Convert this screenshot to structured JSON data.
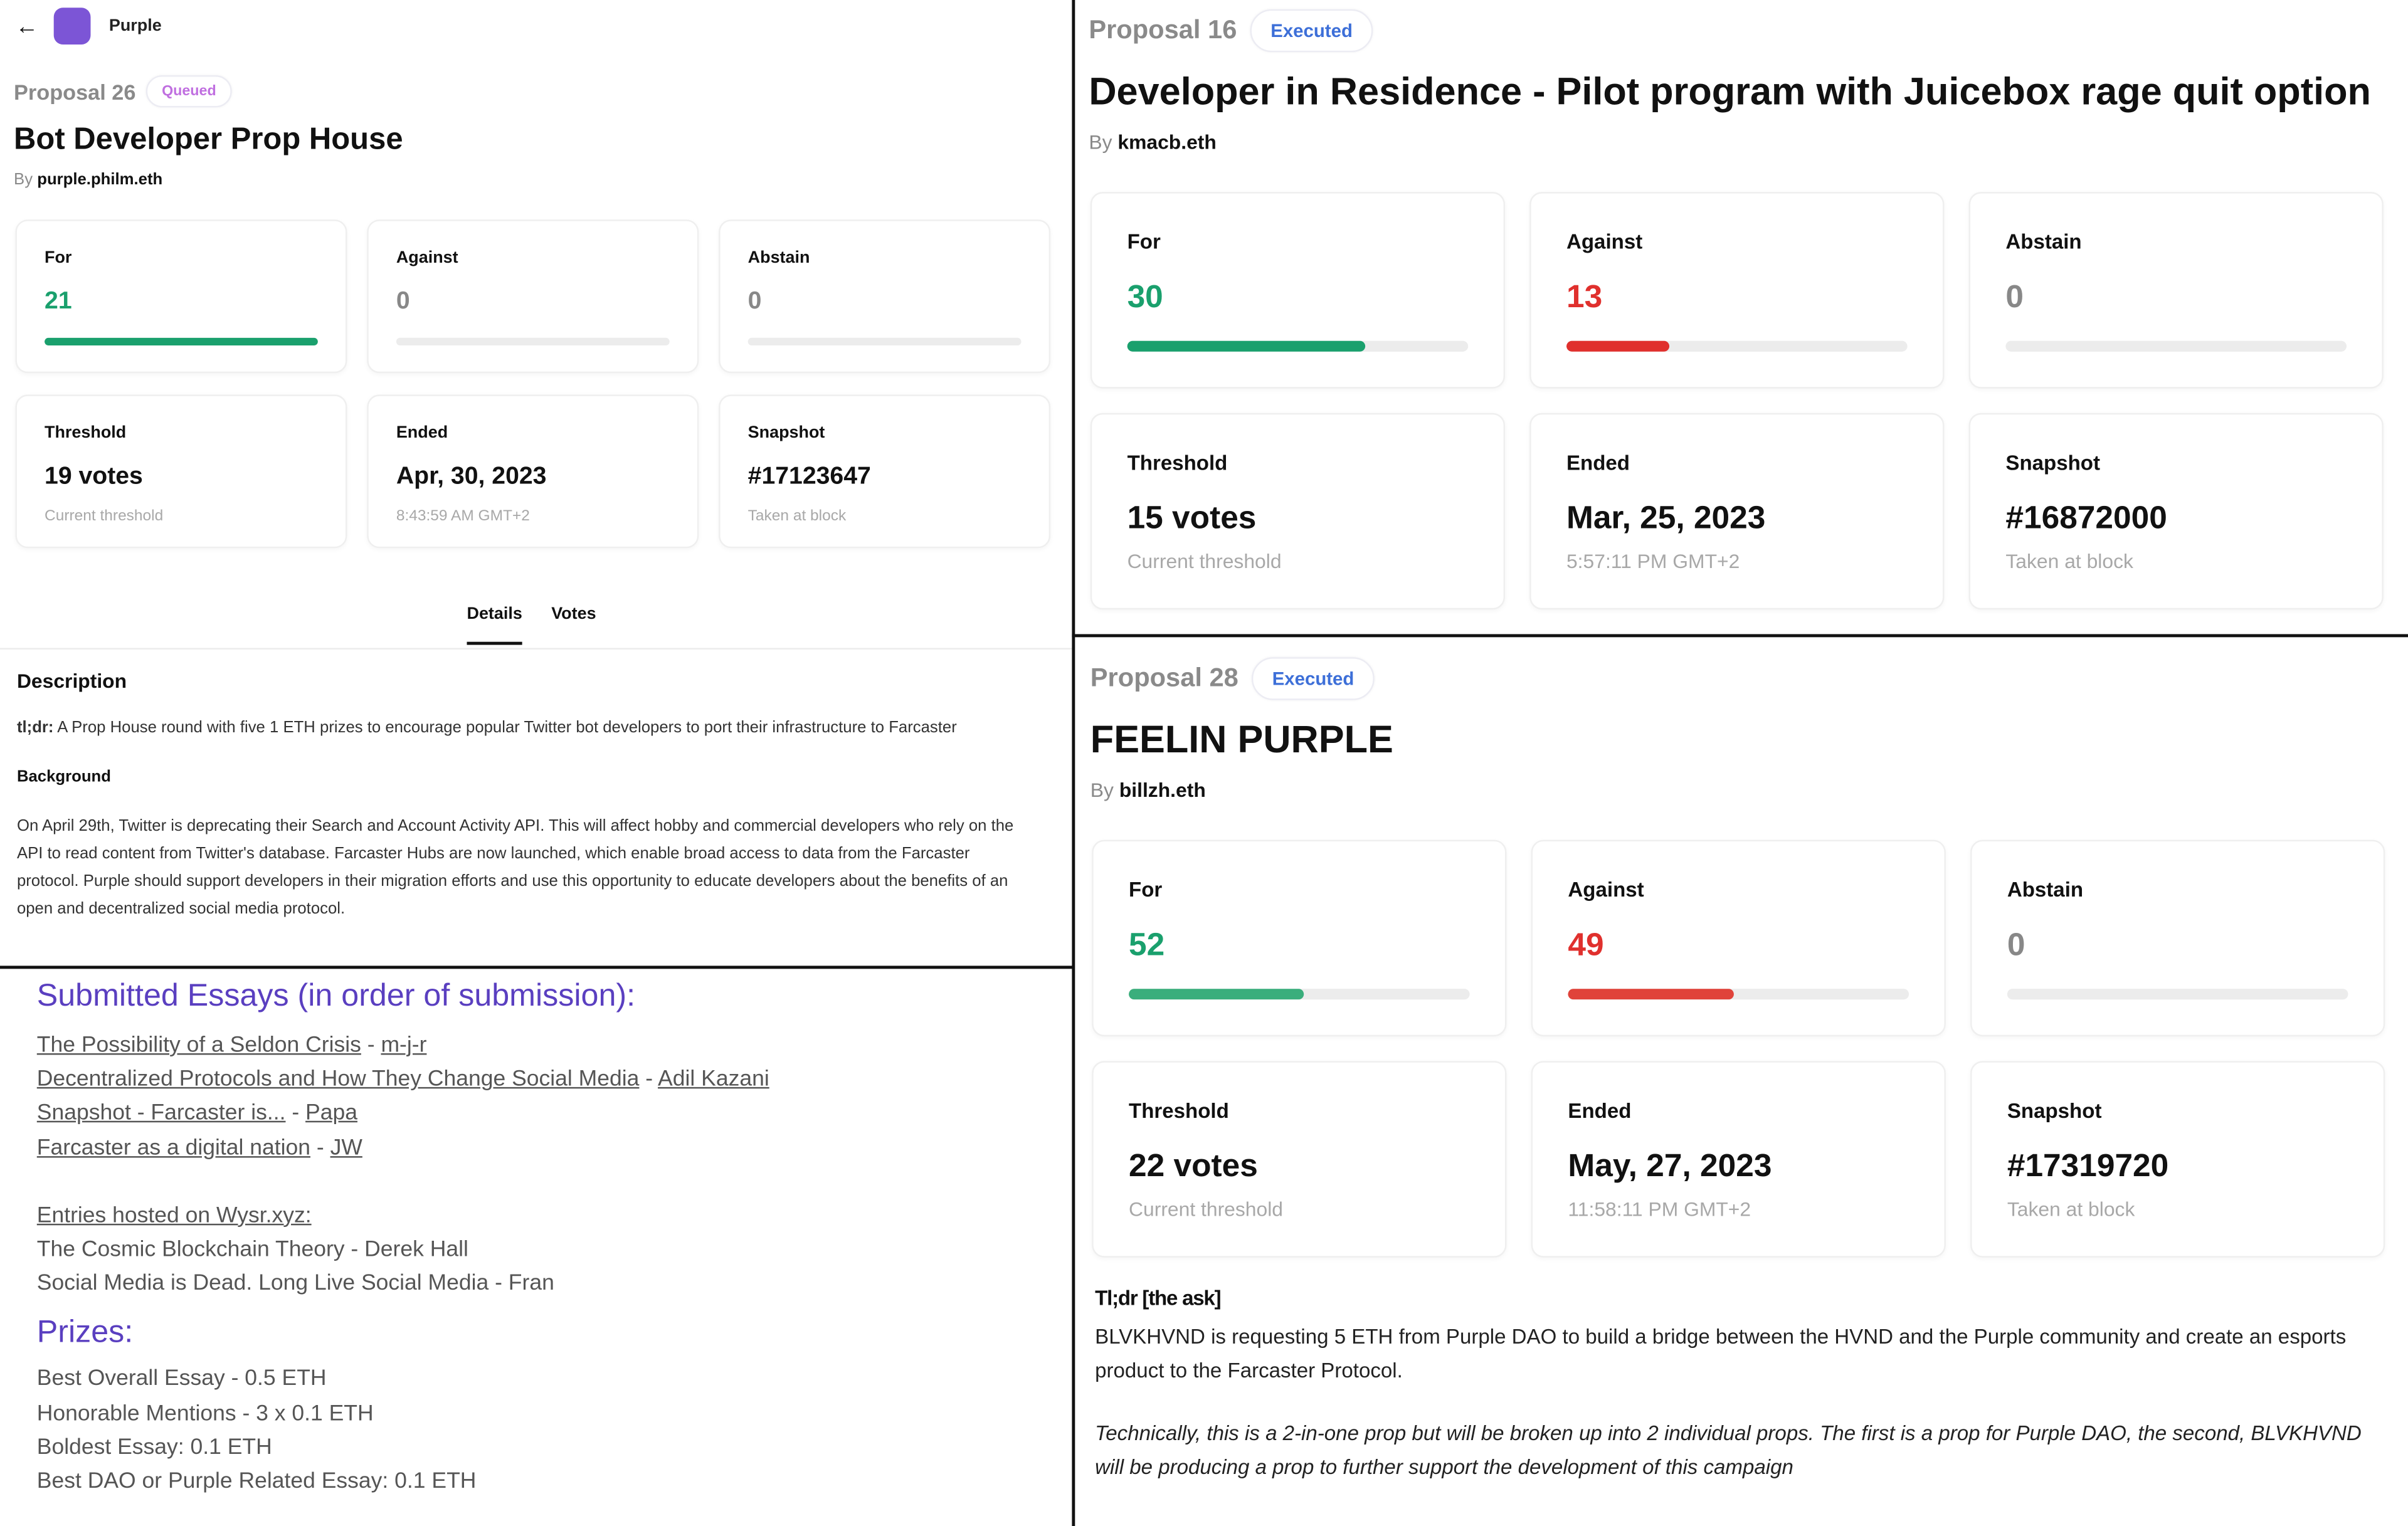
{
  "nav": {
    "back_label": "←",
    "dao_name": "Purple",
    "logo_color": "#7c55d6"
  },
  "colors": {
    "for": "#1aa06d",
    "against": "#e0302d",
    "abstain": "#888888",
    "queued": "#c06fe0",
    "executed": "#3d6fd8",
    "heading_purple": "#5a3fc0"
  },
  "proposals": [
    {
      "number": "Proposal 26",
      "status": "Queued",
      "title": "Bot Developer Prop House",
      "by_label": "By",
      "author": "purple.philm.eth",
      "votes": {
        "for": {
          "label": "For",
          "value": "21",
          "share": 1.0
        },
        "against": {
          "label": "Against",
          "value": "0",
          "share": 0
        },
        "abstain": {
          "label": "Abstain",
          "value": "0",
          "share": 0
        }
      },
      "threshold": {
        "label": "Threshold",
        "value": "19 votes",
        "sub": "Current threshold"
      },
      "ended": {
        "label": "Ended",
        "value": "Apr, 30, 2023",
        "sub": "8:43:59 AM GMT+2"
      },
      "snapshot": {
        "label": "Snapshot",
        "value": "#17123647",
        "sub": "Taken at block"
      },
      "tabs": [
        {
          "label": "Details",
          "active": true
        },
        {
          "label": "Votes",
          "active": false
        }
      ],
      "description": {
        "heading": "Description",
        "tldr_label": "tl;dr:",
        "tldr_text": " A Prop House round with five 1 ETH prizes to encourage popular Twitter bot developers to port their infrastructure to Farcaster",
        "background_heading": "Background",
        "background_text": "On April 29th, Twitter is deprecating their Search and Account Activity API. This will affect hobby and commercial developers who rely on the API to read content from Twitter's database. Farcaster Hubs are now launched, which enable broad access to data from the Farcaster protocol. Purple should support developers in their migration efforts and use this opportunity to educate developers about the benefits of an open and decentralized social media protocol."
      }
    },
    {
      "number": "Proposal 16",
      "status": "Executed",
      "title": "Developer in Residence - Pilot program with Juicebox rage quit option",
      "by_label": "By",
      "author": "kmacb.eth",
      "votes": {
        "for": {
          "label": "For",
          "value": "30",
          "share": 0.698
        },
        "against": {
          "label": "Against",
          "value": "13",
          "share": 0.302
        },
        "abstain": {
          "label": "Abstain",
          "value": "0",
          "share": 0
        }
      },
      "threshold": {
        "label": "Threshold",
        "value": "15 votes",
        "sub": "Current threshold"
      },
      "ended": {
        "label": "Ended",
        "value": "Mar, 25, 2023",
        "sub": "5:57:11 PM GMT+2"
      },
      "snapshot": {
        "label": "Snapshot",
        "value": "#16872000",
        "sub": "Taken at block"
      }
    },
    {
      "number": "Proposal 28",
      "status": "Executed",
      "title": "FEELIN PURPLE",
      "by_label": "By",
      "author": "billzh.eth",
      "votes": {
        "for": {
          "label": "For",
          "value": "52",
          "share": 0.515
        },
        "against": {
          "label": "Against",
          "value": "49",
          "share": 0.485
        },
        "abstain": {
          "label": "Abstain",
          "value": "0",
          "share": 0
        }
      },
      "threshold": {
        "label": "Threshold",
        "value": "22 votes",
        "sub": "Current threshold"
      },
      "ended": {
        "label": "Ended",
        "value": "May, 27, 2023",
        "sub": "11:58:11 PM GMT+2"
      },
      "snapshot": {
        "label": "Snapshot",
        "value": "#17319720",
        "sub": "Taken at block"
      },
      "ask": {
        "heading": "Tl;dr [the ask]",
        "text": "BLVKHVND is requesting 5 ETH from Purple DAO to build a bridge between the HVND and the Purple community and create an esports product to the Farcaster Protocol.",
        "italic": "Technically, this is a 2-in-one prop but will be broken up into 2 individual props. The first is a prop for Purple DAO, the second, BLVKHVND will be producing a prop to further support the development of this campaign"
      }
    }
  ],
  "essays": {
    "heading": "Submitted Essays (in order of submission):",
    "items": [
      {
        "title": "The Possibility of a Seldon Crisis",
        "sep": " - ",
        "author": "m-j-r"
      },
      {
        "title": "Decentralized Protocols and How They Change Social Media",
        "sep": " - ",
        "author": "Adil Kazani"
      },
      {
        "title": "Snapshot - Farcaster is...",
        "sep": " - ",
        "author": "Papa"
      },
      {
        "title": "Farcaster as a digital nation",
        "sep": " - ",
        "author": "JW"
      }
    ],
    "hosted_label": "Entries hosted on Wysr.xyz:",
    "hosted_items": [
      "The Cosmic Blockchain Theory - Derek Hall",
      "Social Media is Dead. Long Live Social Media - Fran"
    ],
    "prizes_heading": "Prizes:",
    "prizes": [
      "Best Overall Essay - 0.5 ETH",
      "Honorable Mentions - 3 x 0.1 ETH",
      "Boldest Essay: 0.1 ETH",
      "Best DAO or Purple Related Essay: 0.1 ETH"
    ]
  }
}
